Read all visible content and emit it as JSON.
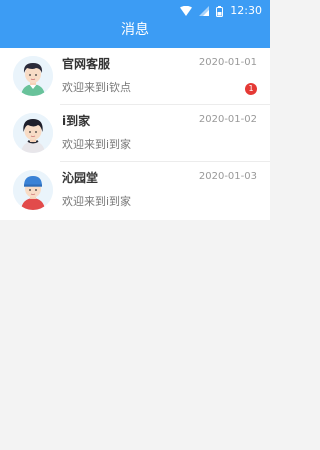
{
  "status_bar": {
    "time": "12:30"
  },
  "header": {
    "title": "消息"
  },
  "colors": {
    "accent": "#3c9cf4",
    "badge": "#e53935"
  },
  "messages": [
    {
      "name": "官网客服",
      "date": "2020-01-01",
      "preview": "欢迎来到i钦点",
      "unread": "1",
      "avatar_icon": "boy-green-shirt-avatar"
    },
    {
      "name": "i到家",
      "date": "2020-01-02",
      "preview": "欢迎来到i到家",
      "avatar_icon": "boy-dark-hair-avatar"
    },
    {
      "name": "沁园堂",
      "date": "2020-01-03",
      "preview": "欢迎来到i到家",
      "avatar_icon": "boy-blue-cap-avatar"
    }
  ]
}
